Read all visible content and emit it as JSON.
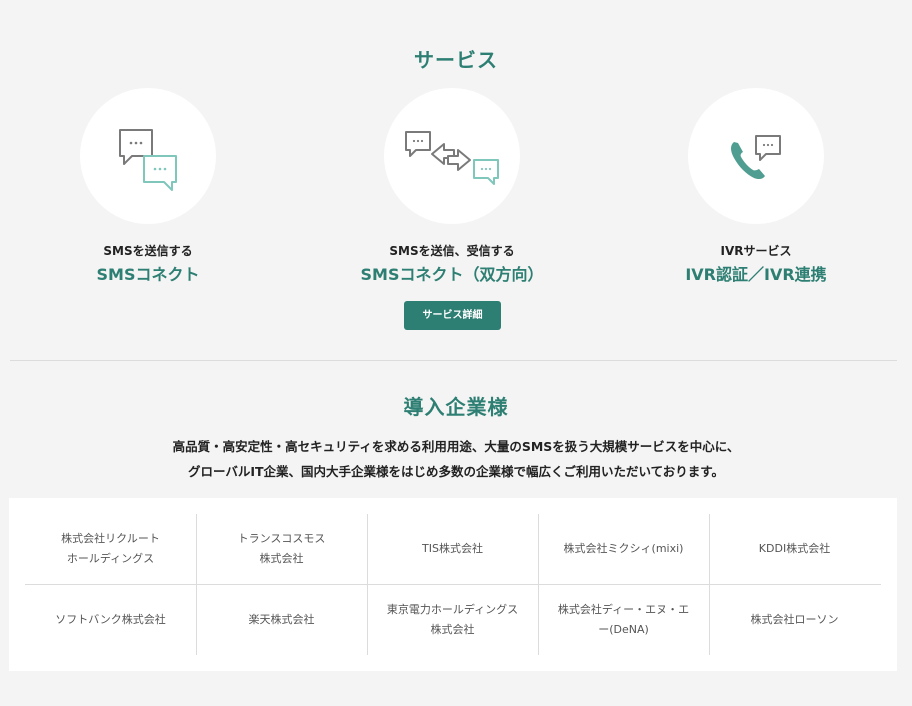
{
  "services": {
    "title": "サービス",
    "items": [
      {
        "sub": "SMSを送信する",
        "name": "SMSコネクト",
        "icon": "chat-bubbles-icon"
      },
      {
        "sub": "SMSを送信、受信する",
        "name": "SMSコネクト（双方向）",
        "icon": "two-way-chat-icon"
      },
      {
        "sub": "IVRサービス",
        "name": "IVR認証／IVR連携",
        "icon": "phone-chat-icon"
      }
    ],
    "button_label": "サービス詳細"
  },
  "clients": {
    "title": "導入企業様",
    "intro_line1": "高品質・高安定性・高セキュリティを求める利用用途、大量のSMSを扱う大規模サービスを中心に、",
    "intro_line2": "グローバルIT企業、国内大手企業様をはじめ多数の企業様で幅広くご利用いただいております。",
    "companies": [
      [
        "株式会社リクルート",
        "ホールディングス"
      ],
      [
        "トランスコスモス",
        "株式会社"
      ],
      [
        "TIS株式会社",
        ""
      ],
      [
        "株式会社ミクシィ(mixi)",
        ""
      ],
      [
        "KDDI株式会社",
        ""
      ],
      [
        "ソフトバンク株式会社",
        ""
      ],
      [
        "楽天株式会社",
        ""
      ],
      [
        "東京電力ホールディングス",
        "株式会社"
      ],
      [
        "株式会社ディー・エヌ・エ",
        "ー(DeNA)"
      ],
      [
        "株式会社ローソン",
        ""
      ]
    ]
  },
  "colors": {
    "accent": "#2e7f73",
    "icon_gray": "#7a7a7a",
    "icon_teal": "#7fc6bb"
  }
}
